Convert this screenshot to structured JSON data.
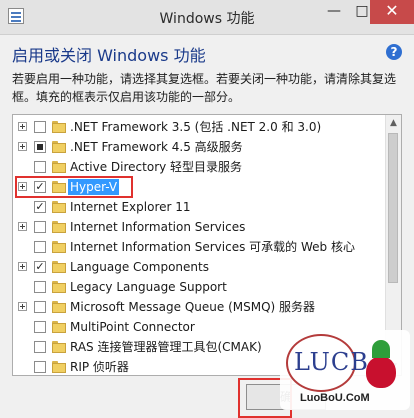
{
  "window": {
    "title": "Windows 功能",
    "min_glyph": "—",
    "max_glyph": "□",
    "close_glyph": "✕"
  },
  "header": {
    "heading": "启用或关闭 Windows 功能",
    "help_glyph": "?"
  },
  "description": "若要启用一种功能，请选择其复选框。若要关闭一种功能，请清除其复选框。填充的框表示仅启用该功能的一部分。",
  "features": [
    {
      "label": ".NET Framework 3.5 (包括 .NET 2.0 和 3.0)",
      "expandable": true,
      "state": "unchecked",
      "selected": false
    },
    {
      "label": ".NET Framework 4.5 高级服务",
      "expandable": true,
      "state": "partial",
      "selected": false
    },
    {
      "label": "Active Directory 轻型目录服务",
      "expandable": false,
      "state": "unchecked",
      "selected": false
    },
    {
      "label": "Hyper-V",
      "expandable": true,
      "state": "checked",
      "selected": true
    },
    {
      "label": "Internet Explorer 11",
      "expandable": false,
      "state": "checked",
      "selected": false
    },
    {
      "label": "Internet Information Services",
      "expandable": true,
      "state": "unchecked",
      "selected": false
    },
    {
      "label": "Internet Information Services 可承载的 Web 核心",
      "expandable": false,
      "state": "unchecked",
      "selected": false
    },
    {
      "label": "Language Components",
      "expandable": true,
      "state": "checked",
      "selected": false
    },
    {
      "label": "Legacy Language Support",
      "expandable": false,
      "state": "unchecked",
      "selected": false
    },
    {
      "label": "Microsoft Message Queue (MSMQ) 服务器",
      "expandable": true,
      "state": "unchecked",
      "selected": false
    },
    {
      "label": "MultiPoint Connector",
      "expandable": false,
      "state": "unchecked",
      "selected": false
    },
    {
      "label": "RAS 连接管理器管理工具包(CMAK)",
      "expandable": false,
      "state": "unchecked",
      "selected": false
    },
    {
      "label": "RIP 侦听器",
      "expandable": false,
      "state": "unchecked",
      "selected": false
    }
  ],
  "footer": {
    "ok_label": "确"
  },
  "watermark": {
    "logo_text": "LUCB",
    "domain": "LuoBoU.CoM"
  },
  "colors": {
    "accent_heading": "#1a3a8a",
    "selection": "#3399ff",
    "highlight_frame": "#e0312e"
  }
}
